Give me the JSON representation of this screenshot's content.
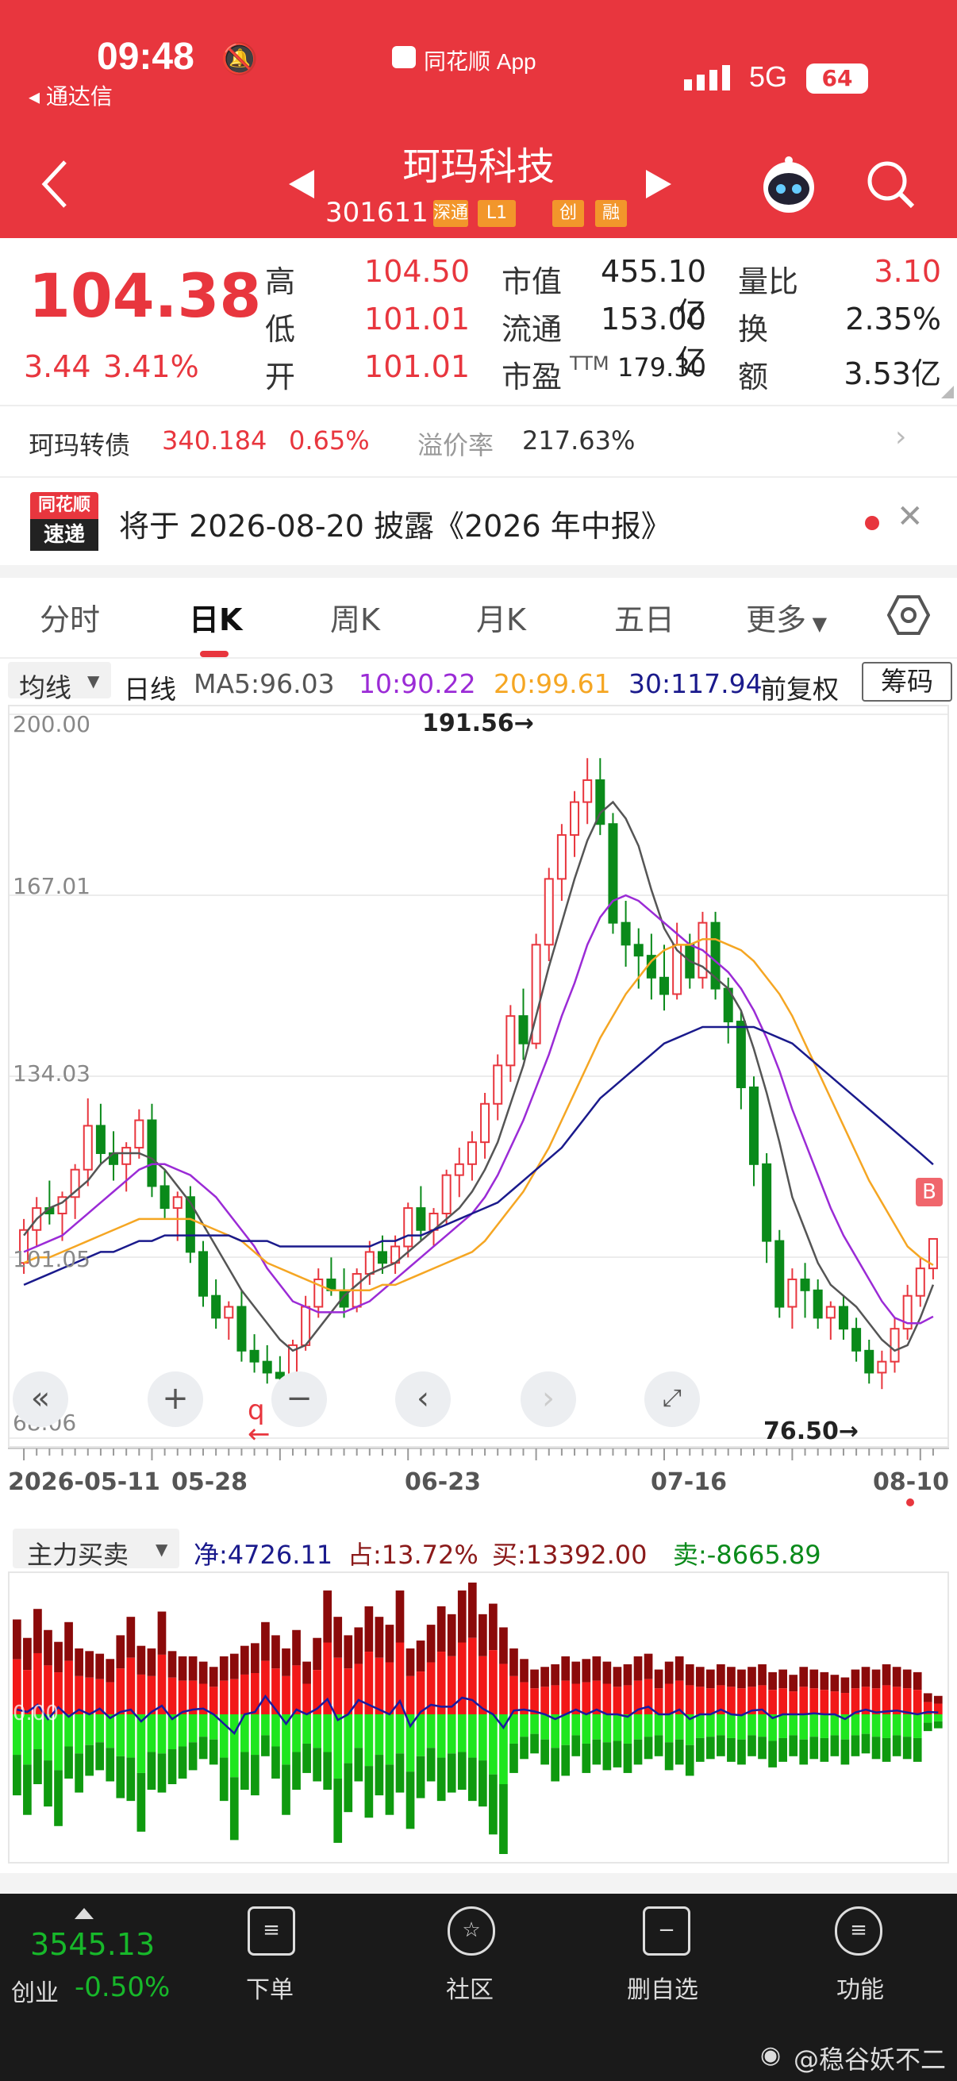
{
  "status_bar": {
    "time": "09:48",
    "back_app": "◂ 通达信",
    "source": "同花顺 App",
    "network": "5G",
    "battery": "64"
  },
  "header": {
    "title": "珂玛科技",
    "code": "301611",
    "tags": [
      "深通",
      "L1",
      "创",
      "融"
    ]
  },
  "quote": {
    "price": "104.38",
    "change": "3.44",
    "change_pct": "3.41%",
    "high_label": "高",
    "high": "104.50",
    "low_label": "低",
    "low": "101.01",
    "open_label": "开",
    "open": "101.01",
    "mcap_label": "市值",
    "mcap": "455.10亿",
    "float_label": "流通",
    "float": "153.00亿",
    "pe_label": "市盈",
    "pe_sup": "TTM",
    "pe": "179.30",
    "vr_label": "量比",
    "vr": "3.10",
    "turn_label": "换",
    "turn": "2.35%",
    "amt_label": "额",
    "amt": "3.53亿"
  },
  "bond": {
    "name": "珂玛转债",
    "price": "340.184",
    "pct": "0.65%",
    "prem_label": "溢价率",
    "prem": "217.63%"
  },
  "notice": {
    "badge_top": "同花顺",
    "badge_bottom": "速递",
    "text": "将于 2026-08-20 披露《2026 年中报》"
  },
  "tabs": [
    "分时",
    "日K",
    "周K",
    "月K",
    "五日",
    "更多"
  ],
  "active_tab": 1,
  "ma_bar": {
    "selector": "均线",
    "period": "日线",
    "ma5": "MA5:96.03",
    "ma10": "10:90.22",
    "ma20": "20:99.61",
    "ma30": "30:117.94",
    "adjust": "前复权",
    "chip": "筹码"
  },
  "colors": {
    "up": "#e8363e",
    "down": "#0a8a1a",
    "ma5": "#555555",
    "ma10": "#9b2bd6",
    "ma20": "#f5a623",
    "ma30": "#1a1a8c",
    "header": "#e8363e"
  },
  "chart_data": {
    "type": "candlestick",
    "y_axis_labels": [
      "200.00",
      "167.01",
      "134.03",
      "101.05",
      "68.06"
    ],
    "ylim": [
      68.06,
      200.0
    ],
    "x_labels": [
      "2026-05-11",
      "05-28",
      "06-23",
      "07-16",
      "08-10"
    ],
    "high_marker": "191.56→",
    "low_marker": "76.50→",
    "candles": [
      [
        100,
        108,
        98,
        106
      ],
      [
        106,
        112,
        103,
        110
      ],
      [
        110,
        115,
        107,
        109
      ],
      [
        109,
        113,
        104,
        112
      ],
      [
        112,
        118,
        108,
        117
      ],
      [
        117,
        130,
        114,
        125
      ],
      [
        125,
        129,
        118,
        120
      ],
      [
        120,
        124,
        115,
        118
      ],
      [
        118,
        122,
        113,
        121
      ],
      [
        121,
        128,
        119,
        126
      ],
      [
        126,
        129,
        112,
        114
      ],
      [
        114,
        117,
        108,
        110
      ],
      [
        110,
        113,
        104,
        112
      ],
      [
        112,
        114,
        100,
        102
      ],
      [
        102,
        104,
        92,
        94
      ],
      [
        94,
        97,
        88,
        90
      ],
      [
        90,
        93,
        86,
        92
      ],
      [
        92,
        95,
        82,
        84
      ],
      [
        84,
        87,
        80,
        82
      ],
      [
        82,
        85,
        78,
        80
      ],
      [
        80,
        83,
        76,
        79
      ],
      [
        79,
        86,
        78,
        85
      ],
      [
        85,
        94,
        84,
        92
      ],
      [
        92,
        99,
        90,
        97
      ],
      [
        97,
        101,
        94,
        95
      ],
      [
        95,
        99,
        90,
        92
      ],
      [
        92,
        99,
        91,
        98
      ],
      [
        98,
        104,
        96,
        102
      ],
      [
        102,
        105,
        98,
        100
      ],
      [
        100,
        105,
        98,
        103
      ],
      [
        103,
        111,
        101,
        110
      ],
      [
        110,
        114,
        104,
        106
      ],
      [
        106,
        110,
        103,
        109
      ],
      [
        109,
        117,
        107,
        116
      ],
      [
        116,
        121,
        112,
        118
      ],
      [
        118,
        124,
        115,
        122
      ],
      [
        122,
        131,
        119,
        129
      ],
      [
        129,
        138,
        126,
        136
      ],
      [
        136,
        147,
        133,
        145
      ],
      [
        145,
        150,
        137,
        140
      ],
      [
        140,
        160,
        139,
        158
      ],
      [
        158,
        172,
        155,
        170
      ],
      [
        170,
        180,
        166,
        178
      ],
      [
        178,
        186,
        174,
        184
      ],
      [
        184,
        192,
        180,
        188
      ],
      [
        188,
        192,
        178,
        180
      ],
      [
        180,
        182,
        160,
        162
      ],
      [
        162,
        166,
        154,
        158
      ],
      [
        158,
        161,
        150,
        156
      ],
      [
        156,
        160,
        148,
        152
      ],
      [
        152,
        158,
        146,
        149
      ],
      [
        149,
        162,
        148,
        158
      ],
      [
        158,
        160,
        150,
        152
      ],
      [
        152,
        164,
        150,
        162
      ],
      [
        162,
        164,
        148,
        150
      ],
      [
        150,
        152,
        140,
        144
      ],
      [
        144,
        146,
        128,
        132
      ],
      [
        132,
        134,
        114,
        118
      ],
      [
        118,
        120,
        100,
        104
      ],
      [
        104,
        106,
        90,
        92
      ],
      [
        92,
        99,
        88,
        97
      ],
      [
        97,
        100,
        90,
        95
      ],
      [
        95,
        97,
        88,
        90
      ],
      [
        90,
        93,
        86,
        92
      ],
      [
        92,
        94,
        86,
        88
      ],
      [
        88,
        90,
        82,
        84
      ],
      [
        84,
        86,
        78,
        80
      ],
      [
        80,
        84,
        77,
        82
      ],
      [
        82,
        90,
        80,
        88
      ],
      [
        88,
        96,
        86,
        94
      ],
      [
        94,
        101,
        92,
        99
      ],
      [
        99,
        104.5,
        97,
        104.38
      ]
    ],
    "ma5": [
      105,
      108,
      110,
      111,
      113,
      115,
      118,
      120,
      120,
      120,
      119,
      117,
      114,
      111,
      107,
      103,
      99,
      95,
      92,
      89,
      86,
      84,
      85,
      88,
      91,
      94,
      96,
      98,
      99,
      100,
      102,
      104,
      106,
      108,
      110,
      113,
      117,
      122,
      129,
      136,
      145,
      154,
      162,
      170,
      177,
      182,
      184,
      181,
      176,
      168,
      161,
      157,
      155,
      154,
      152,
      150,
      146,
      139,
      131,
      122,
      112,
      106,
      100,
      96,
      94,
      92,
      89,
      86,
      84,
      85,
      90,
      96.03
    ],
    "ma10": [
      102,
      103,
      104,
      105,
      107,
      109,
      111,
      113,
      115,
      117,
      118,
      118,
      117,
      116,
      114,
      112,
      109,
      106,
      103,
      99,
      96,
      93,
      92,
      91,
      91,
      91,
      92,
      93,
      95,
      97,
      99,
      101,
      103,
      105,
      107,
      109,
      112,
      116,
      121,
      126,
      132,
      138,
      145,
      151,
      158,
      163,
      166,
      167,
      166,
      164,
      162,
      160,
      158,
      157,
      155,
      153,
      150,
      146,
      141,
      135,
      128,
      122,
      116,
      110,
      105,
      101,
      97,
      93,
      90,
      89,
      89,
      90.22
    ],
    "ma20": [
      100,
      101,
      101,
      102,
      103,
      104,
      105,
      106,
      107,
      108,
      108,
      108,
      108,
      108,
      107,
      106,
      105,
      104,
      102,
      100,
      99,
      98,
      97,
      96,
      95,
      95,
      95,
      95,
      96,
      96,
      97,
      98,
      99,
      100,
      101,
      102,
      104,
      107,
      110,
      113,
      117,
      121,
      126,
      131,
      136,
      141,
      145,
      149,
      152,
      155,
      157,
      158,
      158,
      159,
      159,
      158,
      157,
      155,
      152,
      149,
      145,
      140,
      135,
      130,
      125,
      120,
      115,
      111,
      107,
      103,
      101,
      99.61
    ],
    "ma30": [
      96,
      97,
      98,
      99,
      100,
      101,
      102,
      102,
      103,
      104,
      104,
      105,
      105,
      105,
      105,
      105,
      105,
      104,
      104,
      104,
      103,
      103,
      103,
      103,
      103,
      103,
      103,
      103,
      104,
      104,
      105,
      105,
      106,
      107,
      108,
      109,
      110,
      111,
      113,
      115,
      117,
      119,
      121,
      124,
      127,
      130,
      132,
      134,
      136,
      138,
      140,
      141,
      142,
      143,
      143,
      143,
      143,
      143,
      142,
      141,
      140,
      138,
      136,
      134,
      132,
      130,
      128,
      126,
      124,
      122,
      120,
      117.94
    ]
  },
  "flow": {
    "selector": "主力买卖",
    "net": "净:4726.11",
    "share": "占:13.72%",
    "buy": "买:13392.00",
    "sell": "卖:-8665.89",
    "zero_label": "0.00",
    "buy_vals": [
      0.72,
      0.58,
      0.8,
      0.64,
      0.55,
      0.7,
      0.5,
      0.48,
      0.46,
      0.42,
      0.6,
      0.74,
      0.52,
      0.5,
      0.78,
      0.48,
      0.44,
      0.44,
      0.4,
      0.36,
      0.44,
      0.46,
      0.52,
      0.54,
      0.7,
      0.6,
      0.5,
      0.64,
      0.4,
      0.58,
      0.94,
      0.74,
      0.6,
      0.66,
      0.82,
      0.74,
      0.68,
      0.94,
      0.5,
      0.56,
      0.68,
      0.82,
      0.76,
      0.94,
      1.0,
      0.76,
      0.84,
      0.66,
      0.5,
      0.42,
      0.34,
      0.36,
      0.38,
      0.44,
      0.4,
      0.42,
      0.44,
      0.4,
      0.36,
      0.38,
      0.44,
      0.46,
      0.34,
      0.4,
      0.44,
      0.38,
      0.36,
      0.34,
      0.38,
      0.36,
      0.34,
      0.36,
      0.38,
      0.32,
      0.34,
      0.3,
      0.36,
      0.34,
      0.32,
      0.3,
      0.28,
      0.34,
      0.36,
      0.34,
      0.38,
      0.36,
      0.34,
      0.32,
      0.16,
      0.14
    ],
    "sell_vals": [
      0.58,
      0.72,
      0.5,
      0.66,
      0.8,
      0.46,
      0.56,
      0.44,
      0.4,
      0.48,
      0.6,
      0.62,
      0.84,
      0.54,
      0.56,
      0.5,
      0.46,
      0.4,
      0.32,
      0.36,
      0.62,
      0.9,
      0.54,
      0.58,
      0.3,
      0.46,
      0.72,
      0.54,
      0.42,
      0.48,
      0.54,
      0.92,
      0.7,
      0.48,
      0.74,
      0.58,
      0.72,
      0.56,
      0.82,
      0.6,
      0.48,
      0.62,
      0.56,
      0.54,
      0.62,
      0.66,
      0.86,
      1.0,
      0.42,
      0.32,
      0.28,
      0.36,
      0.48,
      0.44,
      0.3,
      0.42,
      0.36,
      0.4,
      0.38,
      0.42,
      0.36,
      0.32,
      0.3,
      0.4,
      0.36,
      0.44,
      0.34,
      0.32,
      0.3,
      0.34,
      0.36,
      0.3,
      0.32,
      0.38,
      0.34,
      0.3,
      0.36,
      0.32,
      0.34,
      0.3,
      0.36,
      0.3,
      0.28,
      0.32,
      0.34,
      0.3,
      0.32,
      0.34,
      0.12,
      0.1
    ],
    "net_line": [
      0.1,
      0.05,
      0.2,
      -0.1,
      0.15,
      -0.05,
      0.1,
      0.0,
      0.12,
      -0.08,
      0.05,
      0.1,
      -0.15,
      0.05,
      0.18,
      -0.1,
      0.05,
      0.1,
      0.12,
      0.0,
      -0.2,
      -0.4,
      0.0,
      0.05,
      0.38,
      0.1,
      -0.2,
      0.1,
      0.0,
      0.12,
      0.32,
      -0.12,
      0.0,
      0.3,
      0.2,
      0.1,
      0.0,
      0.28,
      -0.25,
      0.05,
      0.2,
      0.16,
      0.16,
      0.35,
      0.3,
      0.12,
      0.0,
      -0.28,
      0.08,
      0.1,
      0.06,
      0.0,
      -0.1,
      0.0,
      0.1,
      0.0,
      0.1,
      0.0,
      0.0,
      -0.05,
      0.1,
      0.16,
      0.0,
      0.0,
      0.1,
      -0.1,
      0.0,
      0.0,
      0.1,
      0.0,
      -0.02,
      0.08,
      0.1,
      -0.08,
      0.0,
      0.0,
      0.0,
      0.02,
      0.0,
      0.0,
      -0.1,
      0.04,
      0.1,
      0.04,
      0.06,
      0.08,
      0.04,
      0.0,
      0.05,
      0.04
    ]
  },
  "bottom_bar": {
    "index_value": "3545.13",
    "index_name": "创业",
    "index_pct": "-0.50%",
    "nav": [
      {
        "label": "下单"
      },
      {
        "label": "社区"
      },
      {
        "label": "删自选"
      },
      {
        "label": "功能"
      }
    ],
    "watermark": "@稳谷妖不二"
  }
}
